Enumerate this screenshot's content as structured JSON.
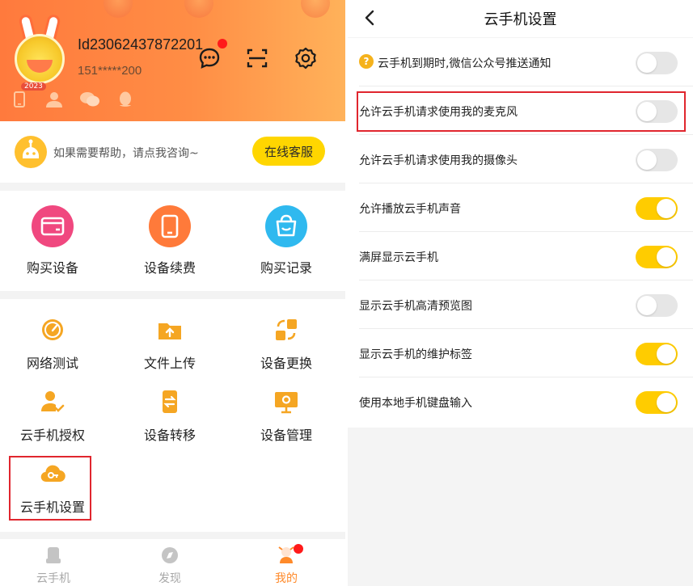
{
  "profile": {
    "user_id": "Id23062437872201",
    "phone": "151*****200",
    "avatar_badge": "2023"
  },
  "help": {
    "text": "如果需要帮助，请点我咨询~",
    "button_label": "在线客服"
  },
  "services": [
    {
      "label": "购买设备",
      "icon": "credit-card-icon",
      "color": "#f0487f"
    },
    {
      "label": "设备续费",
      "icon": "tablet-icon",
      "color": "#ff7a3a"
    },
    {
      "label": "购买记录",
      "icon": "shopping-bag-icon",
      "color": "#2fb9ef"
    }
  ],
  "tools": [
    {
      "label": "网络测试",
      "icon": "speedometer-icon"
    },
    {
      "label": "文件上传",
      "icon": "upload-folder-icon"
    },
    {
      "label": "设备更换",
      "icon": "swap-icon"
    },
    {
      "label": "云手机授权",
      "icon": "user-check-icon"
    },
    {
      "label": "设备转移",
      "icon": "transfer-icon"
    },
    {
      "label": "设备管理",
      "icon": "monitor-gear-icon"
    },
    {
      "label": "云手机设置",
      "icon": "cloud-key-icon"
    }
  ],
  "tabs": [
    {
      "label": "云手机",
      "icon": "phone-tab-icon",
      "active": false
    },
    {
      "label": "发现",
      "icon": "compass-tab-icon",
      "active": false
    },
    {
      "label": "我的",
      "icon": "mine-tab-icon",
      "active": true
    }
  ],
  "settings_page": {
    "title": "云手机设置",
    "rows": [
      {
        "label": "云手机到期时,微信公众号推送通知",
        "enabled": false,
        "help": true
      },
      {
        "label": "允许云手机请求使用我的麦克风",
        "enabled": false,
        "help": false
      },
      {
        "label": "允许云手机请求使用我的摄像头",
        "enabled": false,
        "help": false
      },
      {
        "label": "允许播放云手机声音",
        "enabled": true,
        "help": false
      },
      {
        "label": "满屏显示云手机",
        "enabled": true,
        "help": false
      },
      {
        "label": "显示云手机高清预览图",
        "enabled": false,
        "help": false
      },
      {
        "label": "显示云手机的维护标签",
        "enabled": true,
        "help": false
      },
      {
        "label": "使用本地手机键盘输入",
        "enabled": true,
        "help": false
      }
    ]
  },
  "colors": {
    "accent_yellow": "#ffcc00",
    "header_orange": "#ff8340",
    "highlight_red": "#e0262e",
    "icon_orange": "#f5a623"
  }
}
